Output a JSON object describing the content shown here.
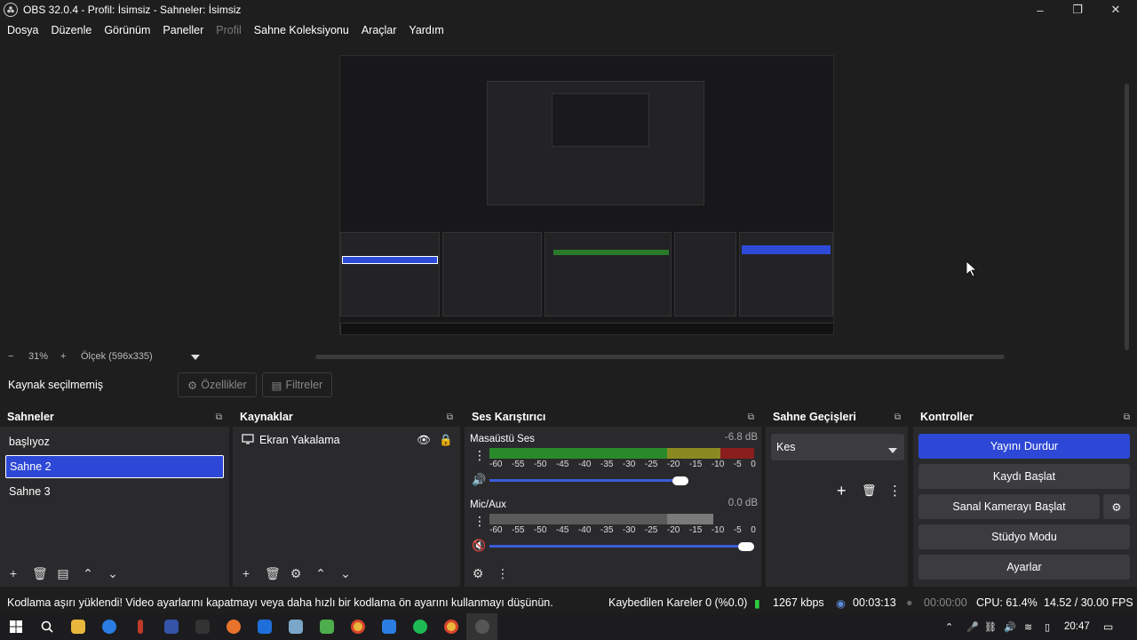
{
  "window": {
    "title": "OBS 32.0.4 - Profil: İsimsiz - Sahneler: İsimsiz",
    "minimize_icon": "–",
    "maximize_icon": "❐",
    "close_icon": "✕"
  },
  "menu": {
    "items": [
      "Dosya",
      "Düzenle",
      "Görünüm",
      "Paneller",
      "Profil",
      "Sahne Koleksiyonu",
      "Araçlar",
      "Yardım"
    ],
    "disabled_index": 4
  },
  "zoom": {
    "minus": "−",
    "value": "31%",
    "plus": "+",
    "scale_label": "Ölçek (596x335)"
  },
  "source_bar": {
    "label": "Kaynak seçilmemiş",
    "properties": "Özellikler",
    "filters": "Filtreler"
  },
  "scenes": {
    "title": "Sahneler",
    "items": [
      "başlıyoz",
      "Sahne 2",
      "Sahne 3"
    ],
    "selected_index": 1
  },
  "sources": {
    "title": "Kaynaklar",
    "items": [
      {
        "name": "Ekran Yakalama",
        "icon": "monitor-icon"
      }
    ]
  },
  "mixer": {
    "title": "Ses Karıştırıcı",
    "ticks": [
      "-60",
      "-55",
      "-50",
      "-45",
      "-40",
      "-35",
      "-30",
      "-25",
      "-20",
      "-15",
      "-10",
      "-5",
      "0"
    ],
    "channels": [
      {
        "name": "Masaüstü Ses",
        "db": "-6.8 dB",
        "volume": 0.8,
        "muted": false
      },
      {
        "name": "Mic/Aux",
        "db": "0.0 dB",
        "volume": 1.0,
        "muted": true
      }
    ]
  },
  "transitions": {
    "title": "Sahne Geçişleri",
    "selected": "Kes"
  },
  "controls": {
    "title": "Kontroller",
    "stream": "Yayını Durdur",
    "record": "Kaydı Başlat",
    "virtual_cam": "Sanal Kamerayı Başlat",
    "studio": "Stüdyo Modu",
    "settings": "Ayarlar"
  },
  "status": {
    "message": "Kodlama aşırı yüklendi! Video ayarlarını kapatmayı veya daha hızlı bir kodlama ön ayarını kullanmayı düşünün.",
    "dropped": "Kaybedilen Kareler 0 (%0.0)",
    "bitrate": "1267 kbps",
    "stream_time": "00:03:13",
    "record_time": "00:00:00",
    "cpu": "CPU: 61.4%",
    "fps": "14.52 / 30.00 FPS"
  },
  "taskbar": {
    "time": "20:47"
  },
  "colors": {
    "accent": "#2d48d6",
    "bg": "#1f1e1f",
    "panel": "#2a2a2d",
    "meter_green": "#2a8a2a",
    "meter_yellow": "#8a8a20",
    "meter_red": "#8a1e1e"
  }
}
